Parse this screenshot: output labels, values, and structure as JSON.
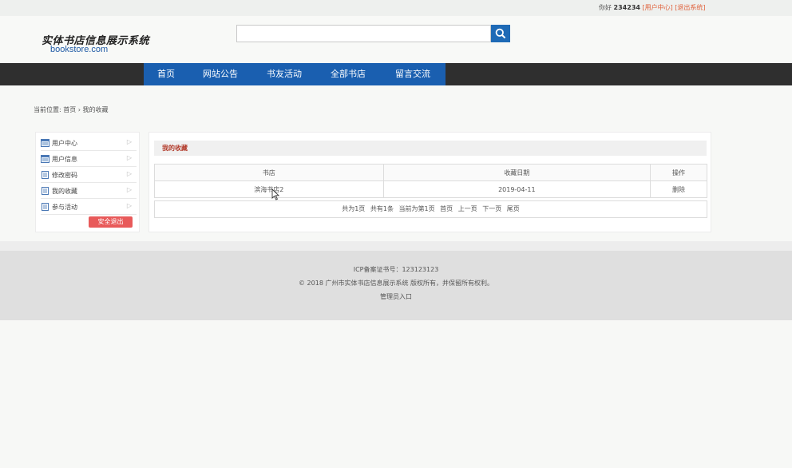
{
  "topbar": {
    "greeting": "你好",
    "username": "234234",
    "user_center_link": "[用户中心]",
    "logout_link": "[退出系统]"
  },
  "header": {
    "logo_cn": "实体书店信息展示系统",
    "logo_en": "bookstore.com",
    "search_placeholder": ""
  },
  "nav": {
    "items": [
      "首页",
      "网站公告",
      "书友活动",
      "全部书店",
      "留言交流"
    ]
  },
  "breadcrumb": "当前位置: 首页 › 我的收藏",
  "sidebar": {
    "items": [
      {
        "label": "用户中心",
        "icon": "window-icon"
      },
      {
        "label": "用户信息",
        "icon": "window-icon"
      },
      {
        "label": "修改密码",
        "icon": "document-icon"
      },
      {
        "label": "我的收藏",
        "icon": "document-icon"
      },
      {
        "label": "参与活动",
        "icon": "document-icon"
      }
    ],
    "logout_button": "安全退出"
  },
  "content": {
    "title": "我的收藏",
    "columns": [
      "书店",
      "收藏日期",
      "操作"
    ],
    "rows": [
      {
        "store": "滨海书店2",
        "date": "2019-04-11",
        "action": "删除"
      }
    ],
    "pager": {
      "total_pages": "共为1页",
      "total_items": "共有1条",
      "current": "当前为第1页",
      "first": "首页",
      "prev": "上一页",
      "next": "下一页",
      "last": "尾页"
    }
  },
  "footer": {
    "icp": "ICP备案证书号：123123123",
    "copyright": "© 2018 广州市实体书店信息展示系统 版权所有，并保留所有权利。",
    "admin_link": "管理员入口"
  },
  "colors": {
    "nav_blue": "#1a5fb0",
    "nav_dark": "#2f2f2f",
    "accent_red": "#e85a5a",
    "link_orange": "#e0603a"
  }
}
